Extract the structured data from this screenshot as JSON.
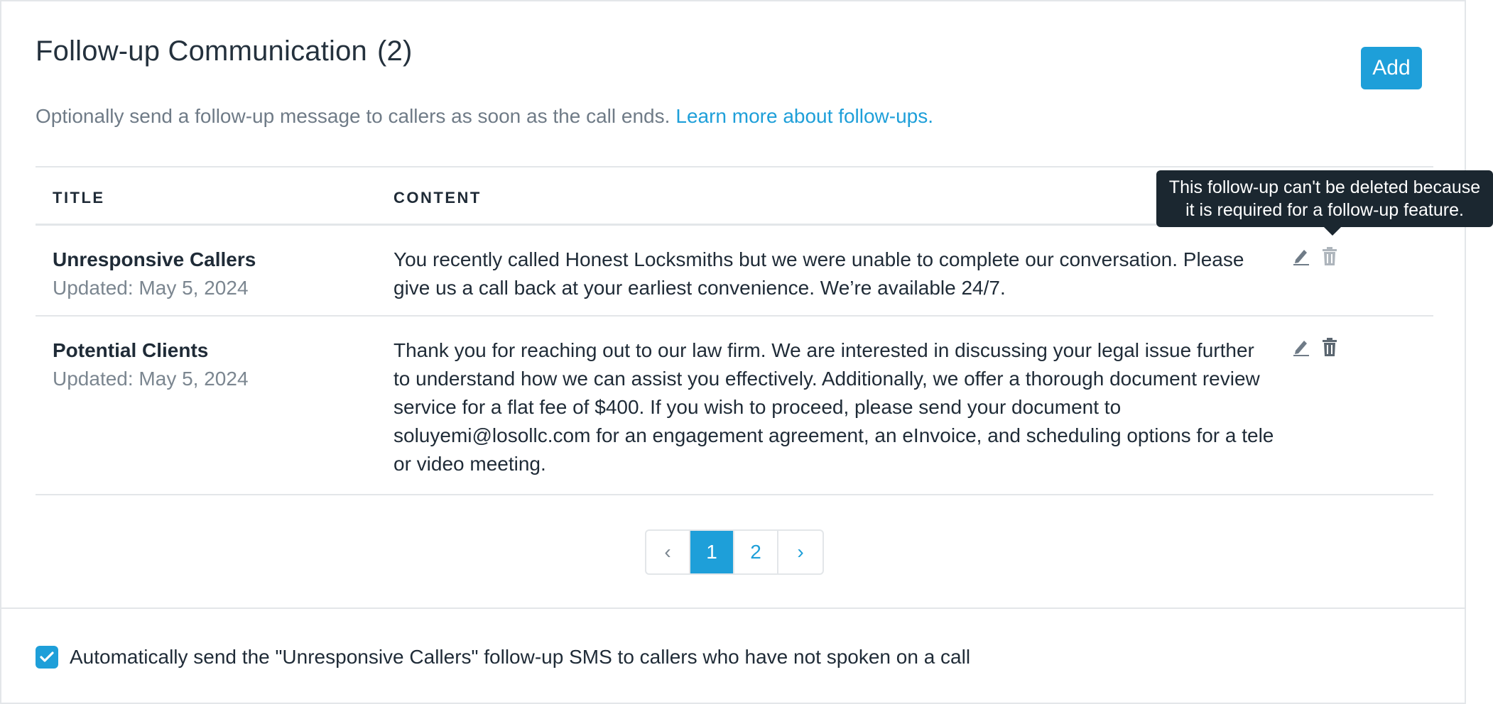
{
  "header": {
    "title": "Follow-up Communication",
    "count": "(2)",
    "add_label": "Add",
    "description": "Optionally send a follow-up message to callers as soon as the call ends.",
    "learn_more": "Learn more about follow-ups."
  },
  "table": {
    "columns": [
      "TITLE",
      "CONTENT"
    ],
    "rows": [
      {
        "title": "Unresponsive Callers",
        "updated": "Updated: May 5, 2024",
        "content": "You recently called Honest Locksmiths but we were unable to complete our conversation. Please give us a call back at your earliest convenience. We’re available 24/7."
      },
      {
        "title": "Potential Clients",
        "updated": "Updated: May 5, 2024",
        "content": "Thank you for reaching out to our law firm. We are interested in discussing your legal issue further to understand how we can assist you effectively. Additionally, we offer a thorough document review service for a flat fee of $400. If you wish to proceed, please send your document to soluyemi@losollc.com for an engagement agreement, an eInvoice, and scheduling options for a tele or video meeting."
      }
    ]
  },
  "tooltip": {
    "text": "This follow-up can't be deleted because it is required for a follow-up feature."
  },
  "pagination": {
    "prev": "‹",
    "pages": [
      "1",
      "2"
    ],
    "current": "1",
    "next": "›"
  },
  "footer": {
    "checkbox_checked": true,
    "checkbox_label": "Automatically send the \"Unresponsive Callers\" follow-up SMS to callers who have not spoken on a call"
  },
  "colors": {
    "accent": "#1e9fd9",
    "tooltip_bg": "#1b2730",
    "border": "#e3e6e9"
  },
  "icons": {
    "edit": "pencil-icon",
    "delete": "trash-icon",
    "check": "checkmark-icon"
  }
}
